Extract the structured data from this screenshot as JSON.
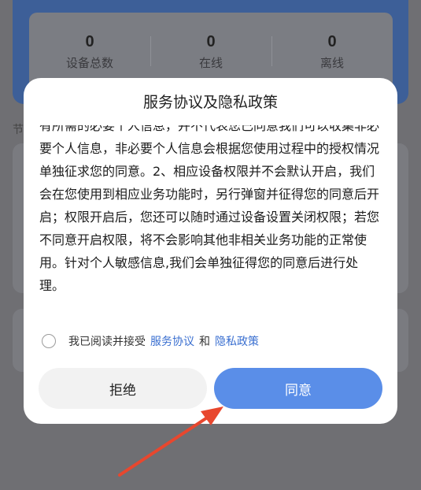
{
  "stats": [
    {
      "value": "0",
      "label": "设备总数"
    },
    {
      "value": "0",
      "label": "在线"
    },
    {
      "value": "0",
      "label": "离线"
    }
  ],
  "background": {
    "section_label": "节"
  },
  "dialog": {
    "title": "服务协议及隐私政策",
    "body": "有所需的必要个人信息，并不代表您已同意我们可以收集非必要个人信息，非必要个人信息会根据您使用过程中的授权情况单独征求您的同意。2、相应设备权限并不会默认开启，我们会在您使用到相应业务功能时，另行弹窗并征得您的同意后开启；权限开启后，您还可以随时通过设备设置关闭权限；若您不同意开启权限，将不会影响其他非相关业务功能的正常使用。针对个人敏感信息,我们会单独征得您的同意后进行处理。",
    "agree_prefix": "我已阅读并接受",
    "terms_link": "服务协议",
    "and_text": "和",
    "privacy_link": "隐私政策",
    "decline_label": "拒绝",
    "agree_label": "同意"
  },
  "colors": {
    "primary": "#5a8ee8",
    "link": "#3a6fd0",
    "arrow": "#e8472e"
  }
}
